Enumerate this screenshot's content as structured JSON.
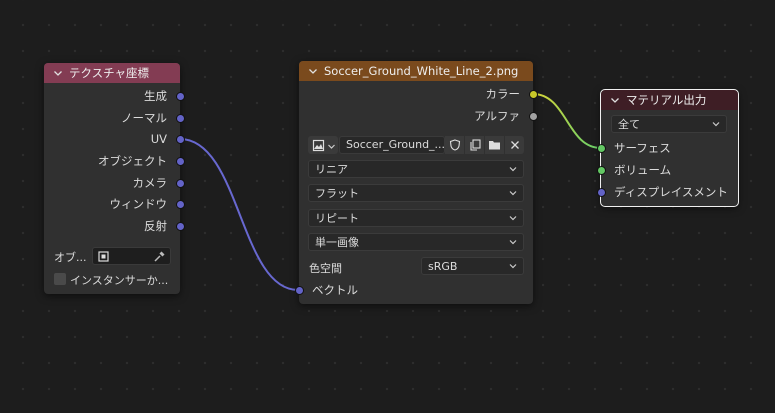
{
  "nodes": {
    "texture_coordinate": {
      "title": "テクスチャ座標",
      "header_color": "#833c53",
      "outputs": [
        "生成",
        "ノーマル",
        "UV",
        "オブジェクト",
        "カメラ",
        "ウィンドウ",
        "反射"
      ],
      "object_label": "オブ...",
      "instancer_label": "インスタンサーか..."
    },
    "image_texture": {
      "title": "Soccer_Ground_White_Line_2.png",
      "header_color": "#7a4a1d",
      "outputs": [
        "カラー",
        "アルファ"
      ],
      "image_name": "Soccer_Ground_...",
      "interpolation": "リニア",
      "projection": "フラット",
      "extension": "リピート",
      "source": "単一画像",
      "color_space_label": "色空間",
      "color_space": "sRGB",
      "input_vector": "ベクトル"
    },
    "material_output": {
      "title": "マテリアル出力",
      "header_color": "#3e1e25",
      "target": "全て",
      "inputs": [
        "サーフェス",
        "ボリューム",
        "ディスプレイスメント"
      ]
    }
  },
  "colors": {
    "socket_vector": "#6363c7",
    "socket_color": "#c7c729",
    "socket_float": "#a1a1a1",
    "socket_shader": "#63c763"
  }
}
